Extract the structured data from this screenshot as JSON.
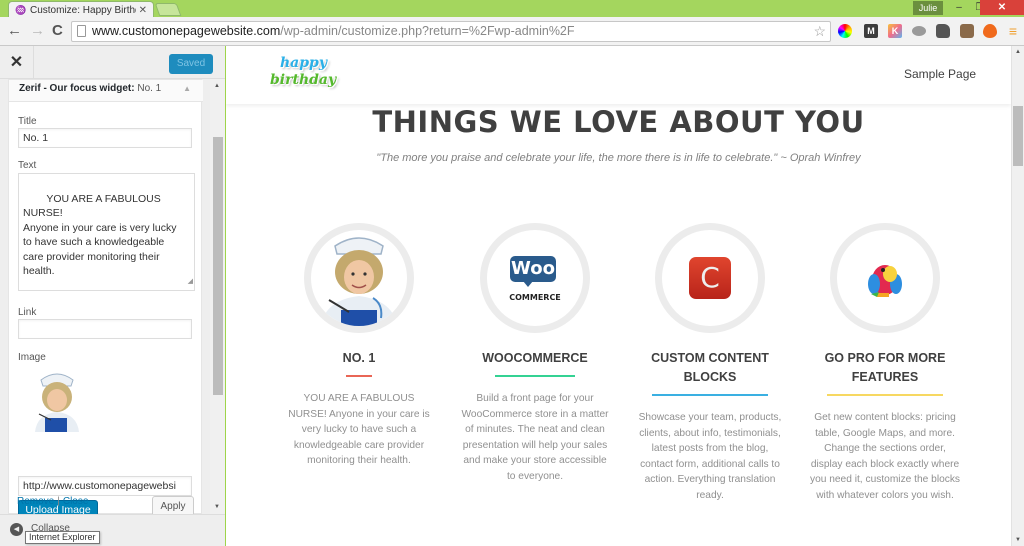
{
  "browser": {
    "tab_title": "Customize: Happy Birthda",
    "tab_close": "✕",
    "user_badge": "Julie",
    "window_buttons": {
      "minimize": "–",
      "maximize": "❐",
      "close": "✕"
    },
    "nav": {
      "back": "←",
      "forward": "→",
      "reload": "C"
    },
    "url_host": "www.customonepagewebsite.com",
    "url_path": "/wp-admin/customize.php?return=%2Fwp-admin%2F",
    "bookmark_star": "☆",
    "extensions": [
      {
        "name": "color-wheel-extension",
        "label": "",
        "color": "#ffffff"
      },
      {
        "name": "m-extension",
        "label": "M",
        "color": "#3d3d3d"
      },
      {
        "name": "k-extension",
        "label": "K",
        "color": "#f2a33c"
      },
      {
        "name": "eye-extension",
        "label": "",
        "color": "#9a9a9a"
      },
      {
        "name": "evernote-extension",
        "label": "",
        "color": "#555555"
      },
      {
        "name": "instagram-extension",
        "label": "",
        "color": "#8a6a4a"
      },
      {
        "name": "fire-extension",
        "label": "",
        "color": "#f06a1c"
      },
      {
        "name": "menu",
        "label": "≡",
        "color": "#f0a030"
      }
    ]
  },
  "sidebar": {
    "close_icon": "✕",
    "saved_label": "Saved",
    "widget": {
      "title_bold": "Zerif - Our focus widget:",
      "title_suffix": "No. 1",
      "title_label": "Title",
      "title_value": "No. 1",
      "text_label": "Text",
      "text_value": "YOU ARE A FABULOUS NURSE!\nAnyone in your care is very lucky\nto have such a knowledgeable\ncare provider monitoring their\nhealth.",
      "link_label": "Link",
      "link_value": "",
      "image_label": "Image",
      "image_url": "http://www.customonepagewebsi",
      "upload_label": "Upload Image",
      "remove_label": "Remove",
      "separator": "|",
      "close_label": "Close",
      "apply_label": "Apply"
    },
    "collapse_label": "Collapse",
    "tooltip": "Internet Explorer"
  },
  "preview": {
    "nav_link": "Sample Page",
    "logo_top": "happy",
    "logo_bottom": "birthday",
    "section_title": "THINGS WE LOVE ABOUT YOU",
    "section_quote": "\"The more you praise and celebrate your life, the more there is in life to celebrate.\" ~ Oprah Winfrey",
    "focus_items": [
      {
        "title": "NO. 1",
        "rule_color": "#e96656",
        "desc": "YOU ARE A FABULOUS NURSE! Anyone in your care is very lucky to have such a knowledgeable care provider monitoring their health."
      },
      {
        "title": "WOOCOMMERCE",
        "rule_color": "#34d293",
        "desc": "Build a front page for your WooCommerce store in a matter of minutes. The neat and clean presentation will help your sales and make your store accessible to everyone.",
        "logo_top": "Woo",
        "logo_bottom": "COMMERCE"
      },
      {
        "title": "CUSTOM CONTENT BLOCKS",
        "rule_color": "#3ab0e2",
        "desc": "Showcase your team, products, clients, about info, testimonials, latest posts from the blog, contact form, additional calls to action. Everything translation ready.",
        "logo": "C"
      },
      {
        "title": "GO PRO FOR MORE FEATURES",
        "rule_color": "#f7d861",
        "desc": "Get new content blocks: pricing table, Google Maps, and more. Change the sections order, display each block exactly where you need it, customize the blocks with whatever colors you wish."
      }
    ]
  }
}
